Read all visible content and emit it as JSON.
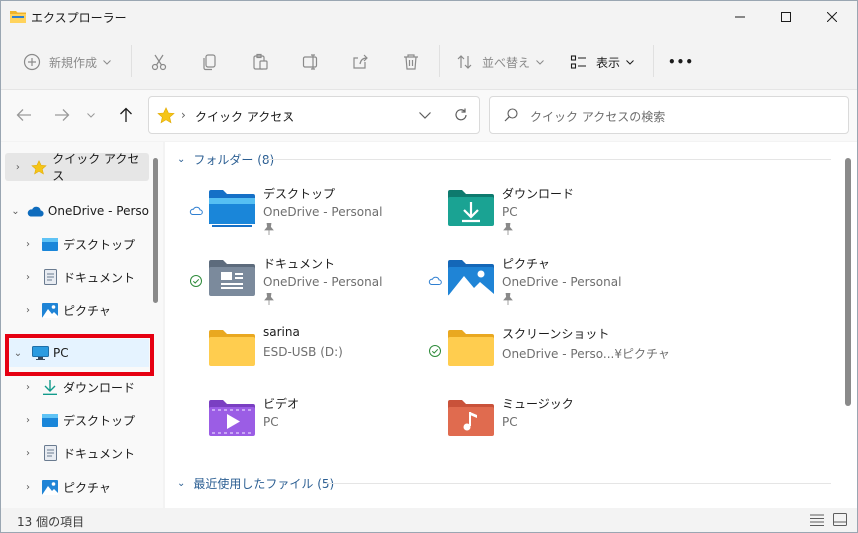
{
  "window": {
    "title": "エクスプローラー"
  },
  "toolbar": {
    "new_label": "新規作成",
    "sort_label": "並べ替え",
    "view_label": "表示",
    "more_label": "•••"
  },
  "address": {
    "path_separator": "›",
    "location": "クイック アクセス"
  },
  "search": {
    "placeholder": "クイック アクセスの検索"
  },
  "sidebar": {
    "items": [
      {
        "label": "クイック アクセス",
        "chevron": "›",
        "icon": "star-icon"
      },
      {
        "label": "OneDrive - Perso",
        "chevron": "⌄",
        "icon": "cloud-icon"
      },
      {
        "label": "デスクトップ",
        "chevron": "›",
        "icon": "desktop-icon"
      },
      {
        "label": "ドキュメント",
        "chevron": "›",
        "icon": "document-icon"
      },
      {
        "label": "ピクチャ",
        "chevron": "›",
        "icon": "pictures-icon"
      },
      {
        "label": "PC",
        "chevron": "⌄",
        "icon": "monitor-icon"
      },
      {
        "label": "ダウンロード",
        "chevron": "›",
        "icon": "download-icon"
      },
      {
        "label": "デスクトップ",
        "chevron": "›",
        "icon": "desktop-icon"
      },
      {
        "label": "ドキュメント",
        "chevron": "›",
        "icon": "document-icon"
      },
      {
        "label": "ピクチャ",
        "chevron": "›",
        "icon": "pictures-icon"
      }
    ]
  },
  "groups": {
    "folders": {
      "label": "フォルダー (8)",
      "chevron": "⌄"
    },
    "recent": {
      "label": "最近使用したファイル (5)",
      "chevron": "⌄"
    }
  },
  "folders": [
    {
      "name": "デスクトップ",
      "location": "OneDrive - Personal",
      "status": "cloud",
      "pinned": true,
      "icon": "desktop-folder-icon"
    },
    {
      "name": "ダウンロード",
      "location": "PC",
      "status": "",
      "pinned": true,
      "icon": "downloads-folder-icon"
    },
    {
      "name": "ドキュメント",
      "location": "OneDrive - Personal",
      "status": "check",
      "pinned": true,
      "icon": "documents-folder-icon"
    },
    {
      "name": "ピクチャ",
      "location": "OneDrive - Personal",
      "status": "cloud",
      "pinned": true,
      "icon": "pictures-folder-icon"
    },
    {
      "name": "sarina",
      "location": "ESD-USB (D:)",
      "status": "",
      "pinned": false,
      "icon": "folder-icon"
    },
    {
      "name": "スクリーンショット",
      "location": "OneDrive - Perso...¥ピクチャ",
      "status": "check",
      "pinned": false,
      "icon": "folder-icon"
    },
    {
      "name": "ビデオ",
      "location": "PC",
      "status": "",
      "pinned": false,
      "icon": "videos-folder-icon"
    },
    {
      "name": "ミュージック",
      "location": "PC",
      "status": "",
      "pinned": false,
      "icon": "music-folder-icon"
    }
  ],
  "statusbar": {
    "item_count": "13 個の項目"
  },
  "colors": {
    "accent": "#0067c0",
    "highlight_box": "#e60012",
    "selected": "#e5f3ff"
  }
}
